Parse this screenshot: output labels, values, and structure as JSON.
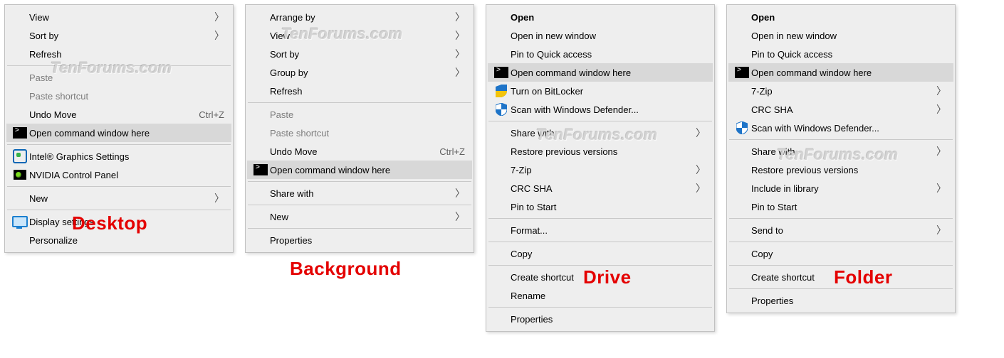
{
  "watermark": "TenForums.com",
  "overlays": {
    "desktop": "Desktop",
    "background": "Background",
    "drive": "Drive",
    "folder": "Folder"
  },
  "common": {
    "arrow": "〉"
  },
  "menus": {
    "desktop": {
      "view": "View",
      "sort_by": "Sort by",
      "refresh": "Refresh",
      "paste": "Paste",
      "paste_shortcut": "Paste shortcut",
      "undo_move": "Undo Move",
      "undo_move_shortcut": "Ctrl+Z",
      "open_cmd": "Open command window here",
      "intel": "Intel® Graphics Settings",
      "nvidia": "NVIDIA Control Panel",
      "new": "New",
      "display_settings": "Display settings",
      "personalize": "Personalize"
    },
    "background": {
      "arrange_by": "Arrange by",
      "view": "View",
      "sort_by": "Sort by",
      "group_by": "Group by",
      "refresh": "Refresh",
      "paste": "Paste",
      "paste_shortcut": "Paste shortcut",
      "undo_move": "Undo Move",
      "undo_move_shortcut": "Ctrl+Z",
      "open_cmd": "Open command window here",
      "share_with": "Share with",
      "new": "New",
      "properties": "Properties"
    },
    "drive": {
      "open": "Open",
      "open_new_window": "Open in new window",
      "pin_quick_access": "Pin to Quick access",
      "open_cmd": "Open command window here",
      "bitlocker": "Turn on BitLocker",
      "defender": "Scan with Windows Defender...",
      "share_with": "Share with",
      "restore_versions": "Restore previous versions",
      "seven_zip": "7-Zip",
      "crc_sha": "CRC SHA",
      "pin_start": "Pin to Start",
      "format": "Format...",
      "copy": "Copy",
      "create_shortcut": "Create shortcut",
      "rename": "Rename",
      "properties": "Properties"
    },
    "folder": {
      "open": "Open",
      "open_new_window": "Open in new window",
      "pin_quick_access": "Pin to Quick access",
      "open_cmd": "Open command window here",
      "seven_zip": "7-Zip",
      "crc_sha": "CRC SHA",
      "defender": "Scan with Windows Defender...",
      "share_with": "Share with",
      "restore_versions": "Restore previous versions",
      "include_library": "Include in library",
      "pin_start": "Pin to Start",
      "send_to": "Send to",
      "copy": "Copy",
      "create_shortcut": "Create shortcut",
      "properties": "Properties"
    }
  }
}
